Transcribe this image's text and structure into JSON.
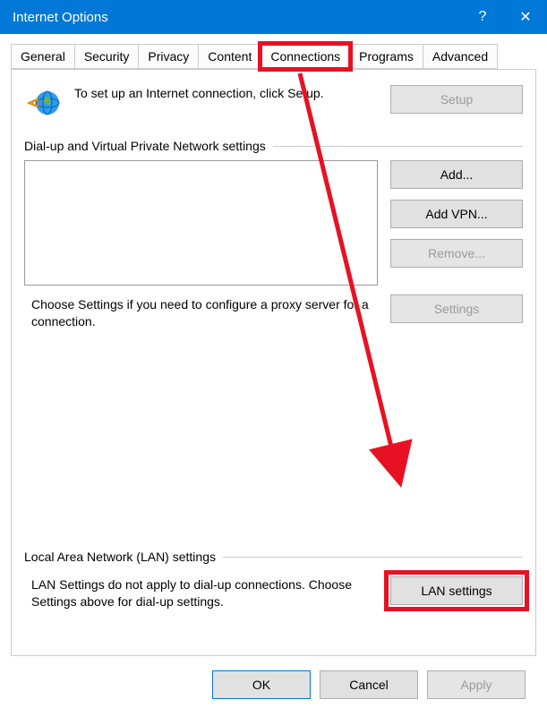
{
  "titlebar": {
    "title": "Internet Options"
  },
  "tabs": {
    "general": "General",
    "security": "Security",
    "privacy": "Privacy",
    "content": "Content",
    "connections": "Connections",
    "programs": "Programs",
    "advanced": "Advanced"
  },
  "setup": {
    "description": "To set up an Internet connection, click Setup.",
    "button": "Setup"
  },
  "dialup": {
    "header": "Dial-up and Virtual Private Network settings",
    "add": "Add...",
    "add_vpn": "Add VPN...",
    "remove": "Remove...",
    "settings": "Settings",
    "note": "Choose Settings if you need to configure a proxy server for a connection."
  },
  "lan": {
    "header": "Local Area Network (LAN) settings",
    "note": "LAN Settings do not apply to dial-up connections. Choose Settings above for dial-up settings.",
    "button": "LAN settings"
  },
  "buttons": {
    "ok": "OK",
    "cancel": "Cancel",
    "apply": "Apply"
  }
}
